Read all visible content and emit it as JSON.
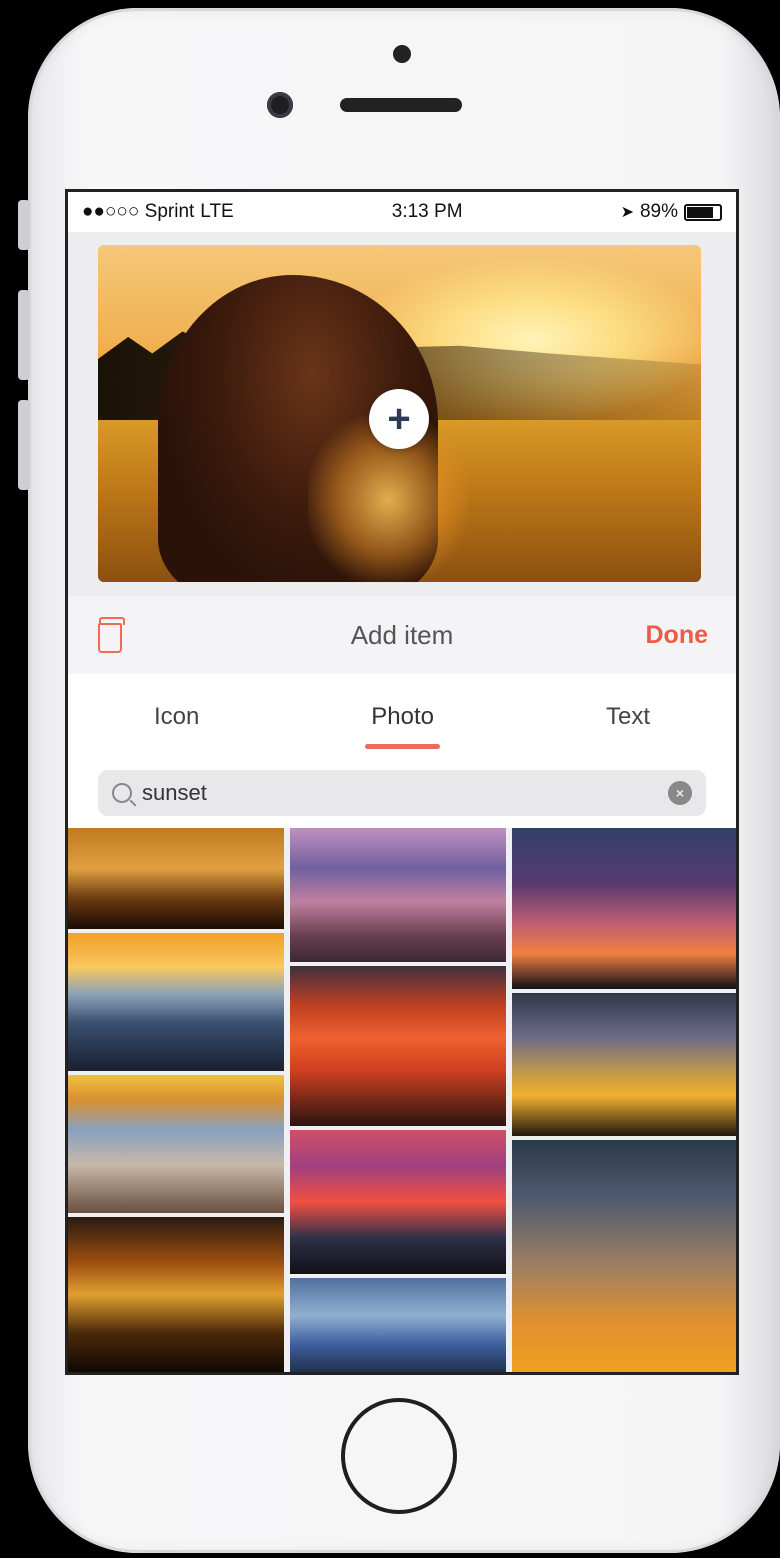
{
  "status_bar": {
    "carrier": "●●○○○ Sprint",
    "network": "LTE",
    "time": "3:13 PM",
    "battery": "89%",
    "location_icon": "location-arrow-icon"
  },
  "preview": {
    "add_icon": "plus-icon"
  },
  "toolbar": {
    "title": "Add item",
    "done_label": "Done",
    "delete_icon": "trash-icon",
    "accent_color": "#ef5a47"
  },
  "tabs": [
    {
      "label": "Icon",
      "active": false
    },
    {
      "label": "Photo",
      "active": true
    },
    {
      "label": "Text",
      "active": false
    }
  ],
  "search": {
    "value": "sunset",
    "placeholder": "",
    "icon": "search-icon",
    "clear_icon": "clear-icon"
  },
  "photo_results": {
    "columns": 3,
    "items": [
      "sunset-photo-1",
      "sunset-photo-2",
      "sunset-photo-3",
      "sunset-photo-4",
      "sunset-photo-5",
      "sunset-photo-6",
      "sunset-photo-7",
      "sunset-photo-8",
      "sunset-photo-9",
      "sunset-photo-10",
      "sunset-photo-11"
    ]
  }
}
